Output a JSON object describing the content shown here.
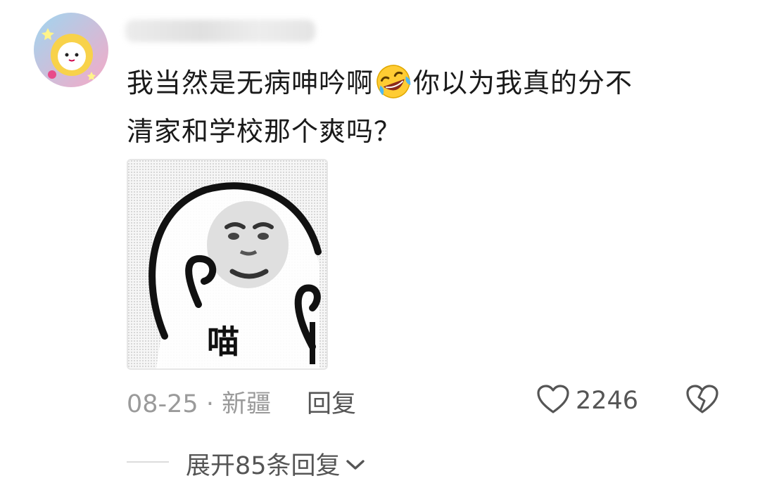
{
  "comment": {
    "text_line1_part1": "我当然是无病呻吟啊",
    "emoji_name": "rofl-emoji",
    "text_line1_part2": "你以为我真的分不",
    "text_line2": "清家和学校那个爽吗？",
    "sticker": {
      "caption": "喵"
    },
    "meta": {
      "date": "08-25",
      "separator": " · ",
      "location": "新疆"
    },
    "reply_label": "回复",
    "likes": "2246",
    "expand_label": "展开85条回复"
  },
  "colors": {
    "text_primary": "#1a1a1a",
    "text_secondary": "#9a9a9a",
    "action_text": "#555555",
    "divider": "#dcdcdc"
  },
  "icons": [
    "heart-outline-icon",
    "broken-heart-icon",
    "chevron-down-icon"
  ]
}
